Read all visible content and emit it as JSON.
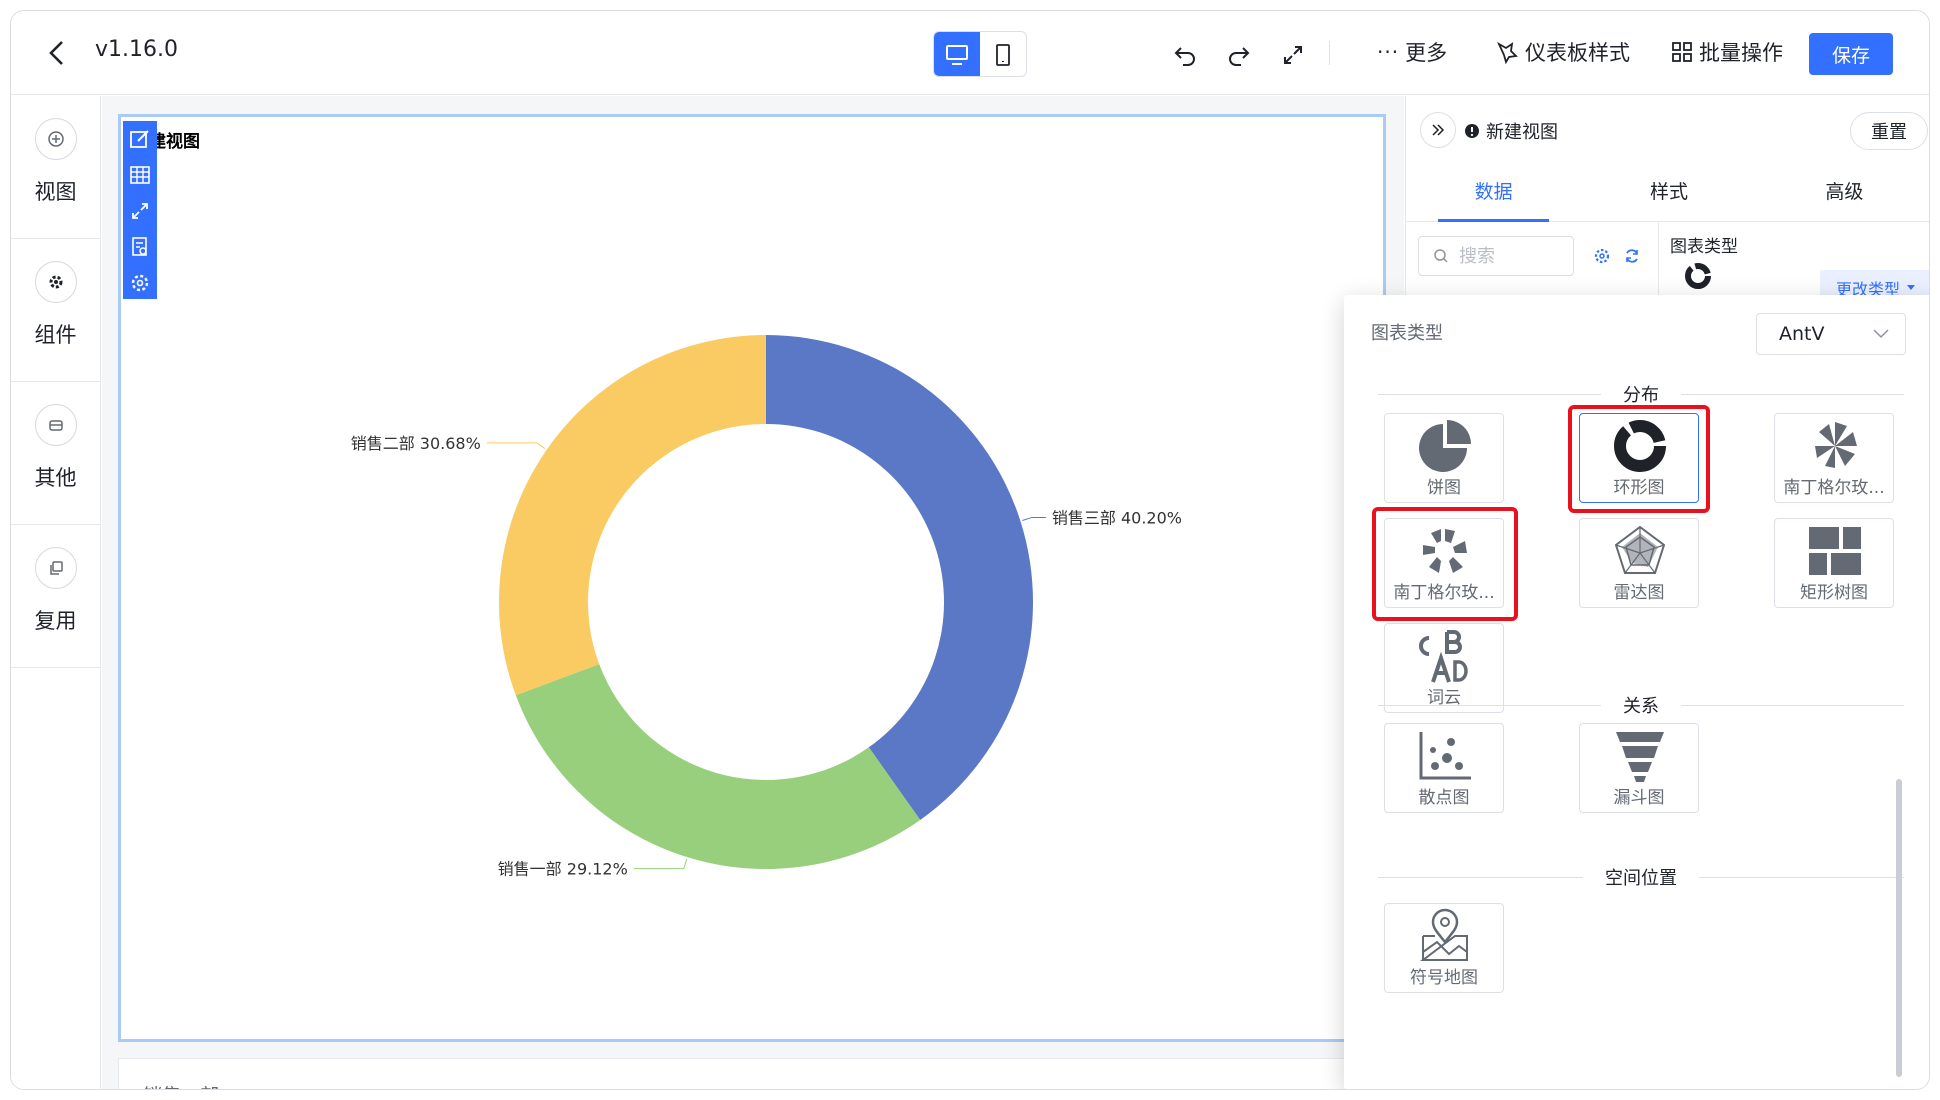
{
  "header": {
    "version": "v1.16.0",
    "more_label": "更多",
    "dashboard_style_label": "仪表板样式",
    "batch_label": "批量操作",
    "save_label": "保存"
  },
  "sidebar": {
    "items": [
      {
        "label": "视图",
        "icon": "plus-circle-icon"
      },
      {
        "label": "组件",
        "icon": "gear-icon"
      },
      {
        "label": "其他",
        "icon": "box-icon"
      },
      {
        "label": "复用",
        "icon": "copy-icon"
      }
    ]
  },
  "canvas": {
    "card_title": "建视图",
    "below_card_text": "销售一部"
  },
  "chart_data": {
    "type": "pie",
    "variant": "donut",
    "categories": [
      "销售三部",
      "销售一部",
      "销售二部"
    ],
    "values": [
      40.2,
      29.12,
      30.68
    ],
    "labels": [
      "销售三部 40.20%",
      "销售一部 29.12%",
      "销售二部 30.68%"
    ],
    "colors": [
      "#5b78c7",
      "#97cf7c",
      "#f9cb62"
    ]
  },
  "panel": {
    "view_name": "新建视图",
    "reset_label": "重置",
    "tabs": [
      "数据",
      "样式",
      "高级"
    ],
    "active_tab": "数据",
    "search_placeholder": "搜索",
    "chart_type_label": "图表类型",
    "change_type_label": "更改类型"
  },
  "popup": {
    "title": "图表类型",
    "library": "AntV",
    "sections": {
      "distribution": "分布",
      "relation": "关系",
      "spatial": "空间位置"
    },
    "charts": {
      "pie": "饼图",
      "donut": "环形图",
      "rose1": "南丁格尔玫...",
      "rose2": "南丁格尔玫...",
      "radar": "雷达图",
      "treemap": "矩形树图",
      "wordcloud": "词云",
      "scatter": "散点图",
      "funnel": "漏斗图",
      "symbol_map": "符号地图"
    }
  }
}
